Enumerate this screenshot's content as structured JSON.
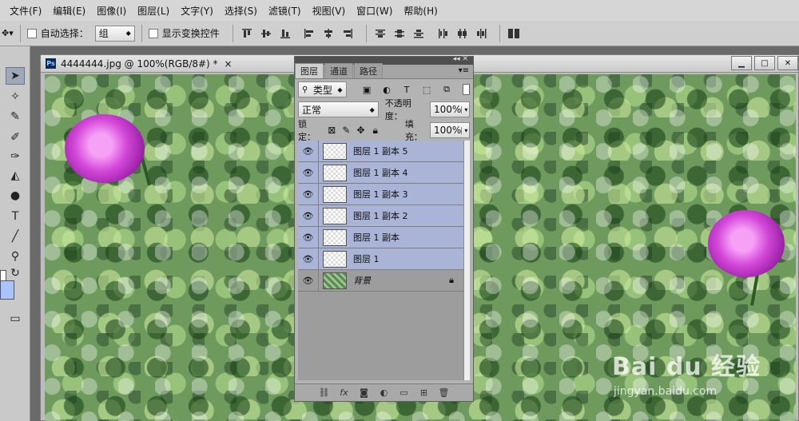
{
  "menu": [
    "文件(F)",
    "编辑(E)",
    "图像(I)",
    "图层(L)",
    "文字(Y)",
    "选择(S)",
    "滤镜(T)",
    "视图(V)",
    "窗口(W)",
    "帮助(H)"
  ],
  "options": {
    "auto_select_label": "自动选择：",
    "auto_select_value": "组",
    "show_transform_label": "显示变换控件"
  },
  "document": {
    "tab_title": "4444444.jpg @ 100%(RGB/8#) *",
    "ps_badge": "Ps",
    "close_glyph": "×"
  },
  "layers_panel": {
    "tabs": [
      "图层",
      "通道",
      "路径"
    ],
    "filter_value": "类型",
    "blend_mode": "正常",
    "opacity_label": "不透明度：",
    "opacity_value": "100%",
    "lock_label": "锁定：",
    "fill_label": "填充：",
    "fill_value": "100%",
    "layers": [
      {
        "name": "图层 1 副本 5",
        "selected": true,
        "type": "transparent"
      },
      {
        "name": "图层 1 副本 4",
        "selected": true,
        "type": "transparent"
      },
      {
        "name": "图层 1 副本 3",
        "selected": true,
        "type": "transparent"
      },
      {
        "name": "图层 1 副本 2",
        "selected": true,
        "type": "transparent"
      },
      {
        "name": "图层 1 副本",
        "selected": true,
        "type": "transparent"
      },
      {
        "name": "图层 1",
        "selected": true,
        "type": "transparent"
      },
      {
        "name": "背景",
        "selected": false,
        "type": "background",
        "locked": true
      }
    ]
  },
  "watermark": {
    "logo": "Bai du 经验",
    "site": "jingyan.baidu.com"
  },
  "colors": {
    "selected_layer": "#a9b4d6",
    "panel": "#b3b3b3",
    "menu_bg": "#d6d6d6"
  }
}
